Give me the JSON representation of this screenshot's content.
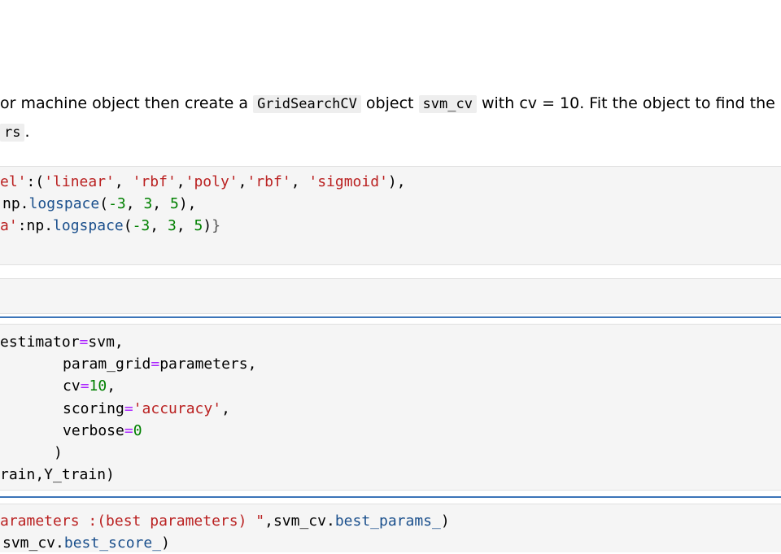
{
  "markdown": {
    "line1_pre": "or machine object then create a ",
    "code1": "GridSearchCV",
    "line1_mid": " object ",
    "code2": "svm_cv",
    "line1_post": " with cv = 10. Fit the object to find the",
    "line2_code": "rs",
    "line2_post": "."
  },
  "cell1": {
    "l1": {
      "a": "el'",
      "b": ":(",
      "c": "'linear'",
      "d": ", ",
      "e": "'rbf'",
      "f": ",",
      "g": "'poly'",
      "h": ",",
      "i": "'rbf'",
      "j": ", ",
      "k": "'sigmoid'",
      "l": "),"
    },
    "l2": {
      "a": "np.",
      "b": "logspace",
      "c": "(",
      "d": "-3",
      "e": ", ",
      "f": "3",
      "g": ", ",
      "h": "5",
      "i": "),"
    },
    "l3": {
      "a": "a'",
      "b": ":np.",
      "c": "logspace",
      "d": "(",
      "e": "-3",
      "f": ", ",
      "g": "3",
      "h": ", ",
      "i": "5",
      "j": ")",
      "k": "}"
    }
  },
  "cell3": {
    "l1": {
      "a": "estimator",
      "b": "=",
      "c": "svm,"
    },
    "l2": {
      "a": "param_grid",
      "b": "=",
      "c": "parameters,"
    },
    "l3": {
      "a": "cv",
      "b": "=",
      "c": "10",
      "d": ","
    },
    "l4": {
      "a": "scoring",
      "b": "=",
      "c": "'accuracy'",
      "d": ","
    },
    "l5": {
      "a": "verbose",
      "b": "=",
      "c": "0"
    },
    "l6": {
      "a": ")"
    },
    "l7": {
      "a": "rain,Y_train)"
    }
  },
  "cell4": {
    "l1": {
      "a": "arameters :(best parameters) \"",
      "b": ",svm_cv.",
      "c": "best_params_",
      "d": ")"
    },
    "l2": {
      "a": "svm_cv.",
      "b": "best_score_",
      "c": ")"
    }
  },
  "colors": {
    "string": "#ba2121",
    "function": "#1a4f8c",
    "number": "#008000",
    "operator": "#aa22ff",
    "separator": "#3b74b8",
    "cell_bg": "#f5f5f5"
  }
}
